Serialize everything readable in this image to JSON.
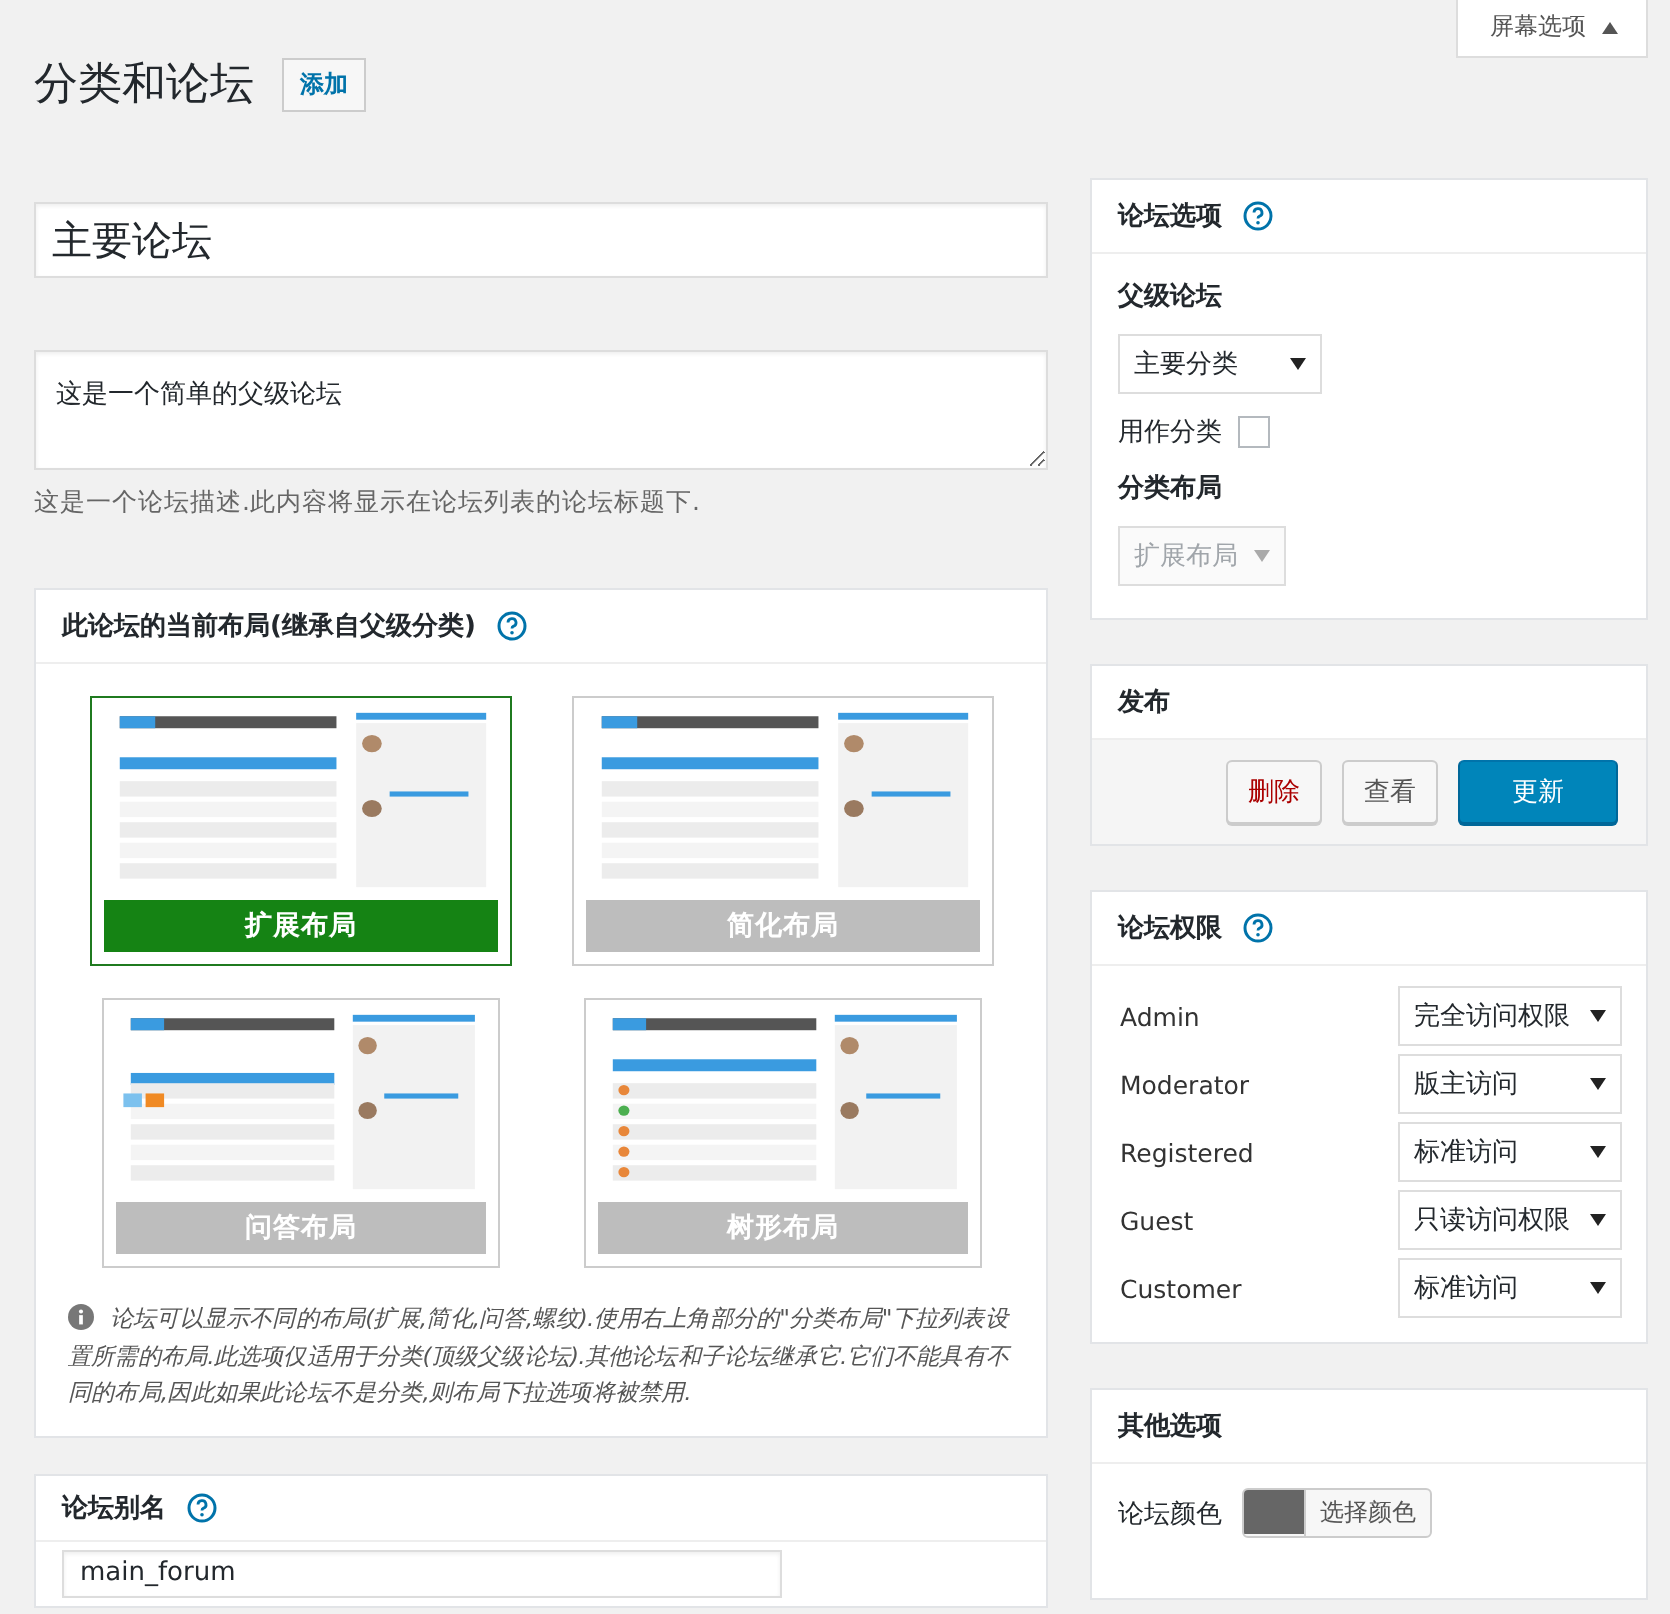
{
  "screen_options": {
    "label": "屏幕选项",
    "expanded": false
  },
  "heading": {
    "title": "分类和论坛",
    "add_button": "添加"
  },
  "forum_title": {
    "value": "主要论坛"
  },
  "description": {
    "value": "这是一个简单的父级论坛",
    "hint": "这是一个论坛描述.此内容将显示在论坛列表的论坛标题下."
  },
  "layout_panel": {
    "title": "此论坛的当前布局(继承自父级分类)",
    "layouts": [
      {
        "label": "扩展布局",
        "selected": true
      },
      {
        "label": "简化布局",
        "selected": false
      },
      {
        "label": "问答布局",
        "selected": false
      },
      {
        "label": "树形布局",
        "selected": false
      }
    ],
    "note": "论坛可以显示不同的布局(扩展,简化,问答,螺纹).使用右上角部分的\"分类布局\"下拉列表设置所需的布局.此选项仅适用于分类(顶级父级论坛).其他论坛和子论坛继承它.它们不能具有不同的布局,因此如果此论坛不是分类,则布局下拉选项将被禁用."
  },
  "slug_panel": {
    "title": "论坛别名",
    "value": "main_forum"
  },
  "forum_options": {
    "title": "论坛选项",
    "parent_label": "父级论坛",
    "parent_value": "主要分类",
    "category_label": "用作分类",
    "category_checked": false,
    "layout_label": "分类布局",
    "layout_value": "扩展布局",
    "layout_disabled": true
  },
  "publish": {
    "title": "发布",
    "buttons": [
      {
        "label": "删除",
        "kind": "danger"
      },
      {
        "label": "查看",
        "kind": "secondary"
      },
      {
        "label": "更新",
        "kind": "primary"
      }
    ]
  },
  "permissions": {
    "title": "论坛权限",
    "rows": [
      {
        "role": "Admin",
        "value": "完全访问权限"
      },
      {
        "role": "Moderator",
        "value": "版主访问"
      },
      {
        "role": "Registered",
        "value": "标准访问"
      },
      {
        "role": "Guest",
        "value": "只读访问权限"
      },
      {
        "role": "Customer",
        "value": "标准访问"
      }
    ]
  },
  "other_options": {
    "title": "其他选项",
    "color_label": "论坛颜色",
    "color": "#666666",
    "color_button": "选择颜色"
  }
}
